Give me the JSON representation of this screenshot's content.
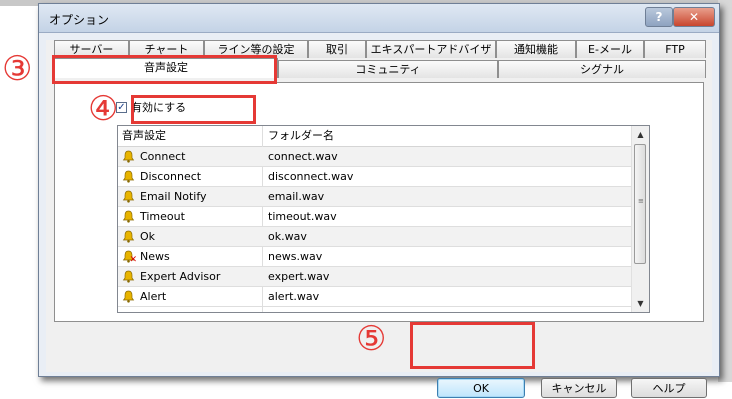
{
  "window": {
    "title": "オプション",
    "help_label": "?",
    "close_label": "✕"
  },
  "tabs_row1": [
    "サーバー",
    "チャート",
    "ライン等の設定",
    "取引",
    "エキスパートアドバイザ",
    "通知機能",
    "E-メール",
    "FTP"
  ],
  "tabs_row2": [
    "音声設定",
    "コミュニティ",
    "シグナル"
  ],
  "enable_checkbox": {
    "label": "有効にする",
    "checked": true
  },
  "sound_list": {
    "columns": [
      "音声設定",
      "フォルダー名"
    ],
    "rows": [
      {
        "event": "Connect",
        "file": "connect.wav",
        "icon": "bell-icon"
      },
      {
        "event": "Disconnect",
        "file": "disconnect.wav",
        "icon": "bell-icon"
      },
      {
        "event": "Email Notify",
        "file": "email.wav",
        "icon": "bell-icon"
      },
      {
        "event": "Timeout",
        "file": "timeout.wav",
        "icon": "bell-icon"
      },
      {
        "event": "Ok",
        "file": "ok.wav",
        "icon": "bell-icon"
      },
      {
        "event": "News",
        "file": "news.wav",
        "icon": "bell-disabled-icon"
      },
      {
        "event": "Expert Advisor",
        "file": "expert.wav",
        "icon": "bell-icon"
      },
      {
        "event": "Alert",
        "file": "alert.wav",
        "icon": "bell-icon"
      }
    ]
  },
  "buttons": {
    "ok": "OK",
    "cancel": "キャンセル",
    "help": "ヘルプ"
  },
  "annotations": {
    "marker3": "③",
    "marker4": "④",
    "marker5": "⑤"
  },
  "colors": {
    "annotation": "#e53935",
    "bell": "#e8b400",
    "disabled_x": "#dd0000"
  }
}
